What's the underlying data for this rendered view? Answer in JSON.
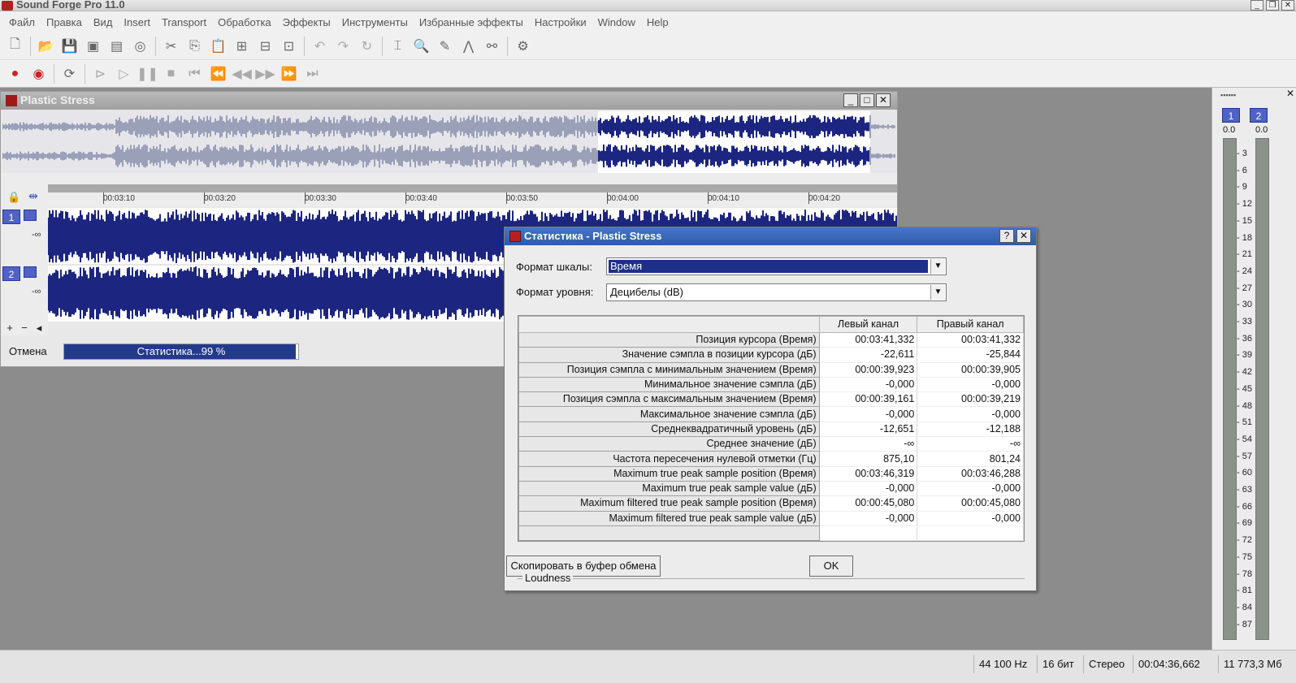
{
  "app": {
    "title": "Sound Forge Pro 11.0",
    "menu": [
      "Файл",
      "Правка",
      "Вид",
      "Insert",
      "Transport",
      "Обработка",
      "Эффекты",
      "Инструменты",
      "Избранные эффекты",
      "Настройки",
      "Window",
      "Help"
    ]
  },
  "data_window": {
    "title": "Plastic Stress",
    "ruler_ticks": [
      "00:03:10",
      "00:03:20",
      "00:03:30",
      "00:03:40",
      "00:03:50",
      "00:04:00",
      "00:04:10",
      "00:04:20"
    ],
    "channels": [
      "1",
      "2"
    ],
    "inf_label": "-∞",
    "cancel_label": "Отмена",
    "progress_text": "Статистика...99 %",
    "progress": 0.99
  },
  "dialog": {
    "title": "Статистика - Plastic Stress",
    "help_btn": "?",
    "close_btn": "✕",
    "scale_format_label": "Формат шкалы:",
    "scale_format_value": "Время",
    "level_format_label": "Формат уровня:",
    "level_format_value": "Децибелы (dB)",
    "columns": [
      "",
      "Левый канал",
      "Правый канал"
    ],
    "rows": [
      {
        "label": "Позиция курсора (Время)",
        "left": "00:03:41,332",
        "right": "00:03:41,332"
      },
      {
        "label": "Значение сэмпла в позиции курсора (дБ)",
        "left": "-22,611",
        "right": "-25,844"
      },
      {
        "label": "Позиция сэмпла с минимальным значением (Время)",
        "left": "00:00:39,923",
        "right": "00:00:39,905"
      },
      {
        "label": "Минимальное значение сэмпла (дБ)",
        "left": "-0,000",
        "right": "-0,000"
      },
      {
        "label": "Позиция сэмпла с максимальным значением (Время)",
        "left": "00:00:39,161",
        "right": "00:00:39,219"
      },
      {
        "label": "Максимальное значение сэмпла (дБ)",
        "left": "-0,000",
        "right": "-0,000"
      },
      {
        "label": "Среднеквадратичный уровень (дБ)",
        "left": "-12,651",
        "right": "-12,188"
      },
      {
        "label": "Среднее значение (дБ)",
        "left": "-∞",
        "right": "-∞"
      },
      {
        "label": "Частота пересечения нулевой отметки (Гц)",
        "left": "875,10",
        "right": "801,24"
      },
      {
        "label": "Maximum true peak sample position (Время)",
        "left": "00:03:46,319",
        "right": "00:03:46,288"
      },
      {
        "label": "Maximum true peak sample value (дБ)",
        "left": "-0,000",
        "right": "-0,000"
      },
      {
        "label": "Maximum filtered true peak sample position (Время)",
        "left": "00:00:45,080",
        "right": "00:00:45,080"
      },
      {
        "label": "Maximum filtered true peak sample value (дБ)",
        "left": "-0,000",
        "right": "-0,000"
      }
    ],
    "copy_button": "Скопировать в буфер обмена",
    "ok_button": "OK",
    "loudness_label": "Loudness"
  },
  "meters": {
    "channels": [
      "1",
      "2"
    ],
    "peak_values": [
      "0.0",
      "0.0"
    ],
    "scale": [
      "3",
      "6",
      "9",
      "12",
      "15",
      "18",
      "21",
      "24",
      "27",
      "30",
      "33",
      "36",
      "39",
      "42",
      "45",
      "48",
      "51",
      "54",
      "57",
      "60",
      "63",
      "66",
      "69",
      "72",
      "75",
      "78",
      "81",
      "84",
      "87"
    ]
  },
  "statusbar": {
    "sample_rate": "44 100 Hz",
    "bit_depth": "16 бит",
    "channels": "Стерео",
    "length": "00:04:36,662",
    "size": "11 773,3 Мб"
  },
  "colors": {
    "waveform": "#1c2680",
    "selection": "#1c2680",
    "overview_wave": "#9aa0b8",
    "dialog_title": "#3a66b8"
  }
}
